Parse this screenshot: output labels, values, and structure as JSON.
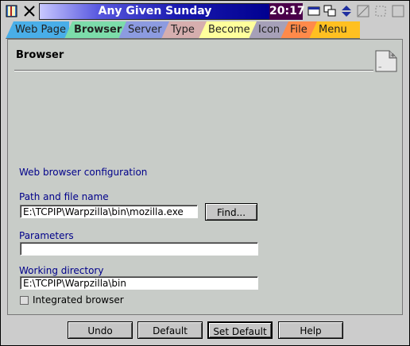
{
  "window": {
    "title": "Any Given Sunday",
    "clock": "20:17"
  },
  "tabs": [
    {
      "label": "Web Page",
      "color": "#49aee8"
    },
    {
      "label": "Browser",
      "color": "#7cdcaa"
    },
    {
      "label": "Server",
      "color": "#8c9be0"
    },
    {
      "label": "Type",
      "color": "#d6aeae"
    },
    {
      "label": "Become",
      "color": "#ffff9c"
    },
    {
      "label": "Icon",
      "color": "#a6a0b8"
    },
    {
      "label": "File",
      "color": "#ff8a4a"
    },
    {
      "label": "Menu",
      "color": "#ffc021"
    }
  ],
  "panel": {
    "header": "Browser",
    "section_title": "Web browser configuration",
    "path_label": "Path and file name",
    "path_value": "E:\\TCPIP\\Warpzilla\\bin\\mozilla.exe",
    "find_button": "Find...",
    "params_label": "Parameters",
    "params_value": "",
    "workdir_label": "Working directory",
    "workdir_value": "E:\\TCPIP\\Warpzilla\\bin",
    "integrated_label": "Integrated browser"
  },
  "buttons": {
    "undo": "Undo",
    "default": "Default",
    "set_default": "Set Default",
    "help": "Help"
  },
  "colors": {
    "label_blue": "#00008a",
    "clock_bg": "#4a004a"
  }
}
